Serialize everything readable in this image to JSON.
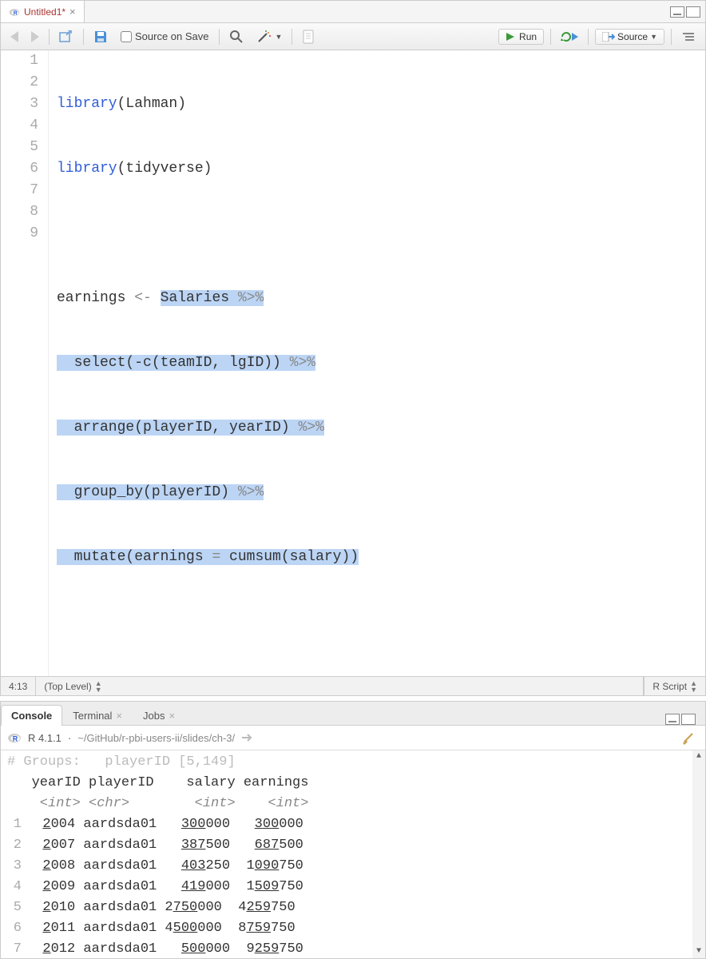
{
  "editor": {
    "tab_title": "Untitled1*",
    "source_on_save_label": "Source on Save",
    "run_label": "Run",
    "source_label": "Source",
    "cursor_pos": "4:13",
    "scope": "(Top Level)",
    "lang": "R Script",
    "lines": {
      "l1a": "library",
      "l1b": "(Lahman)",
      "l2a": "library",
      "l2b": "(tidyverse)",
      "l4a": "earnings ",
      "l4b": "<-",
      "l4c": " ",
      "l4d": "Salaries ",
      "l4e": "%>%",
      "l5a": "  select(-c(teamID, lgID)) ",
      "l5b": "%>%",
      "l6a": "  arrange(playerID, yearID) ",
      "l6b": "%>%",
      "l7a": "  group_by(playerID) ",
      "l7b": "%>%",
      "l8a": "  mutate(earnings ",
      "l8b": "=",
      "l8c": " cumsum(salary))"
    },
    "line_numbers": [
      "1",
      "2",
      "3",
      "4",
      "5",
      "6",
      "7",
      "8",
      "9"
    ]
  },
  "console": {
    "tabs": {
      "console": "Console",
      "terminal": "Terminal",
      "jobs": "Jobs"
    },
    "version": "R 4.1.1",
    "path": "~/GitHub/r-pbi-users-ii/slides/ch-3/",
    "ghost_header": "# Groups:   playerID [5,149]",
    "header": "   yearID playerID    salary earnings",
    "types": "    <int> <chr>        <int>    <int>",
    "rows": [
      {
        "n": "1",
        "year_u": "2",
        "year_r": "004",
        "player": "aardsda01",
        "sal_u": "300",
        "sal_r": "000",
        "earn_pre": "",
        "earn_u": "300",
        "earn_r": "000"
      },
      {
        "n": "2",
        "year_u": "2",
        "year_r": "007",
        "player": "aardsda01",
        "sal_u": "387",
        "sal_r": "500",
        "earn_pre": "",
        "earn_u": "687",
        "earn_r": "500"
      },
      {
        "n": "3",
        "year_u": "2",
        "year_r": "008",
        "player": "aardsda01",
        "sal_u": "403",
        "sal_r": "250",
        "earn_pre": "1",
        "earn_u": "090",
        "earn_r": "750"
      },
      {
        "n": "4",
        "year_u": "2",
        "year_r": "009",
        "player": "aardsda01",
        "sal_u": "419",
        "sal_r": "000",
        "earn_pre": "1",
        "earn_u": "509",
        "earn_r": "750"
      },
      {
        "n": "5",
        "year_u": "2",
        "year_r": "010",
        "player": "aardsda01",
        "sal_u": "",
        "sal_mid": "2",
        "sal_u2": "750",
        "sal_r": "000",
        "earn_pre": "4",
        "earn_u": "259",
        "earn_r": "750"
      },
      {
        "n": "6",
        "year_u": "2",
        "year_r": "011",
        "player": "aardsda01",
        "sal_u": "",
        "sal_mid": "4",
        "sal_u2": "500",
        "sal_r": "000",
        "earn_pre": "8",
        "earn_u": "759",
        "earn_r": "750"
      },
      {
        "n": "7",
        "year_u": "2",
        "year_r": "012",
        "player": "aardsda01",
        "sal_u": "500",
        "sal_r": "000",
        "earn_pre": "9",
        "earn_u": "259",
        "earn_r": "750"
      }
    ]
  }
}
